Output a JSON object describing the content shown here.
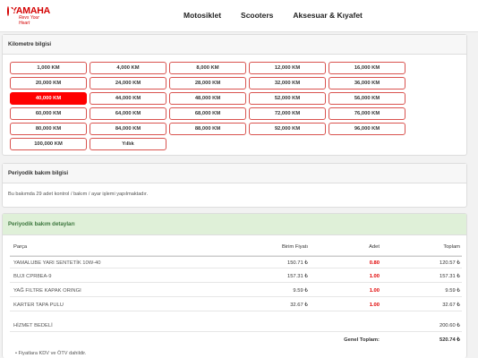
{
  "brand": {
    "name": "YAMAHA",
    "slogan": "Revs Your Heart"
  },
  "nav": [
    "Motosiklet",
    "Scooters",
    "Aksesuar & Kıyafet"
  ],
  "km_panel": {
    "title": "Kilometre bilgisi",
    "selected": "40,000 KM",
    "options": [
      "1,000 KM",
      "4,000 KM",
      "8,000 KM",
      "12,000 KM",
      "16,000 KM",
      "20,000 KM",
      "24,000 KM",
      "28,000 KM",
      "32,000 KM",
      "36,000 KM",
      "40,000 KM",
      "44,000 KM",
      "48,000 KM",
      "52,000 KM",
      "56,000 KM",
      "60,000 KM",
      "64,000 KM",
      "68,000 KM",
      "72,000 KM",
      "76,000 KM",
      "80,000 KM",
      "84,000 KM",
      "88,000 KM",
      "92,000 KM",
      "96,000 KM",
      "100,000 KM",
      "Yıllık"
    ]
  },
  "info_panel": {
    "title": "Periyodik bakım bilgisi",
    "text": "Bu bakımda 29 adet kontrol / bakım / ayar işlemi yapılmaktadır."
  },
  "detail_panel": {
    "title": "Periyodik bakım detayları",
    "headers": {
      "part": "Parça",
      "unit_price": "Birim Fiyatı",
      "qty": "Adet",
      "total": "Toplam"
    },
    "rows": [
      {
        "part": "YAMALUBE YARI SENTETİK 10W-40",
        "unit_price": "150.71 ₺",
        "qty": "0.80",
        "total": "120.57 ₺"
      },
      {
        "part": "BUJI CPR8EA-9",
        "unit_price": "157.31 ₺",
        "qty": "1.00",
        "total": "157.31 ₺"
      },
      {
        "part": "YAĞ FILTRE KAPAK ORINGI",
        "unit_price": "9.59 ₺",
        "qty": "1.00",
        "total": "9.59 ₺"
      },
      {
        "part": "KARTER TAPA PULU",
        "unit_price": "32.67 ₺",
        "qty": "1.00",
        "total": "32.67 ₺"
      }
    ],
    "service": {
      "label": "HİZMET BEDELİ",
      "total": "200.60 ₺"
    },
    "grand_total": {
      "label": "Genel Toplam:",
      "value": "520.74 ₺"
    },
    "note": "• Fiyatlara KDV ve ÖTV dahildir."
  }
}
